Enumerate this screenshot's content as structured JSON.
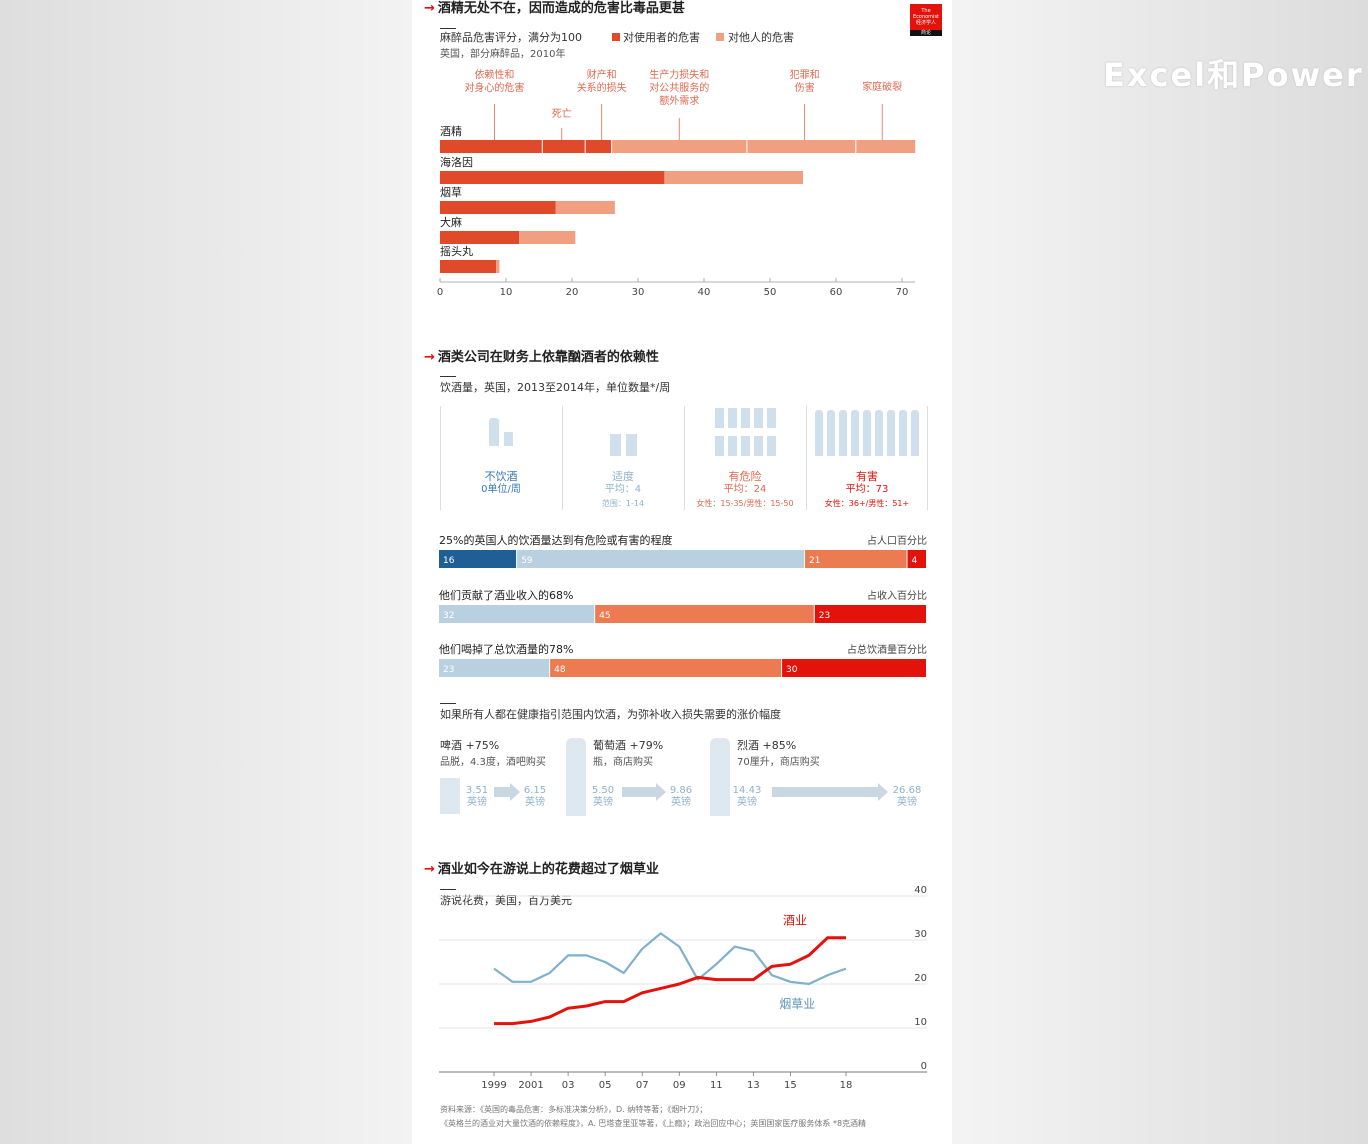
{
  "watermark": "Excel和Power",
  "logo": {
    "line1": "The",
    "line2": "Economist",
    "line3": "经济学人",
    "line4": "商论"
  },
  "section1": {
    "title": "酒精无处不在，因而造成的危害比毒品更甚",
    "subtitle": "麻醉品危害评分，满分为100",
    "legend_user": "对使用者的危害",
    "legend_others": "对他人的危害",
    "note": "英国，部分麻醉品，2010年",
    "annotations": {
      "dependence": "依赖性和\n对身心的危害",
      "death": "死亡",
      "property": "财产和\n关系的损失",
      "productivity": "生产力损失和\n对公共服务的\n额外需求",
      "crime": "犯罪和\n伤害",
      "family": "家庭破裂"
    }
  },
  "section2": {
    "title": "酒类公司在财务上依靠酗酒者的依赖性",
    "subtitle": "饮酒量，英国，2013至2014年，单位数量*/周",
    "groups": [
      {
        "name": "不饮酒",
        "sub1": "0单位/周",
        "sub2": ""
      },
      {
        "name": "适度",
        "sub1": "平均：4",
        "sub2": "范围：1-14"
      },
      {
        "name": "有危险",
        "sub1": "平均：24",
        "sub2": "女性：15-35/男性：15-50"
      },
      {
        "name": "有害",
        "sub1": "平均：73",
        "sub2": "女性：36+/男性：51+"
      }
    ],
    "bars": [
      {
        "label": "25%的英国人的饮酒量达到有危险或有害的程度",
        "unit": "占人口百分比"
      },
      {
        "label": "他们贡献了酒业收入的68%",
        "unit": "占收入百分比"
      },
      {
        "label": "他们喝掉了总饮酒量的78%",
        "unit": "占总饮酒量百分比"
      }
    ],
    "price": {
      "title": "如果所有人都在健康指引范围内饮酒，为弥补收入损失需要的涨价幅度",
      "items": [
        {
          "name": "啤酒 +75%",
          "desc": "品脱，4.3度，酒吧购买",
          "from": "3.51",
          "to": "6.15",
          "unit": "英镑"
        },
        {
          "name": "葡萄酒 +79%",
          "desc": "瓶，商店购买",
          "from": "5.50",
          "to": "9.86",
          "unit": "英镑"
        },
        {
          "name": "烈酒 +85%",
          "desc": "70厘升，商店购买",
          "from": "14.43",
          "to": "26.68",
          "unit": "英镑"
        }
      ]
    }
  },
  "section3": {
    "title": "酒业如今在游说上的花费超过了烟草业",
    "subtitle": "游说花费，美国，百万美元",
    "label_alcohol": "酒业",
    "label_tobacco": "烟草业"
  },
  "source": {
    "line1": "资料来源：《英国的毒品危害：多标准决策分析》，D. 纳特等著；《烟叶刀》；",
    "line2": "《英格兰的酒业对大量饮酒的依赖程度》，A. 巴塔查里亚等著，《上瘾》；政治回应中心；英国国家医疗服务体系   *8克酒精"
  },
  "chart_data": [
    {
      "type": "bar",
      "title": "酒精无处不在，因而造成的危害比毒品更甚",
      "subtitle": "麻醉品危害评分，满分为100",
      "orientation": "horizontal",
      "stacked": true,
      "categories": [
        "酒精",
        "海洛因",
        "烟草",
        "大麻",
        "摇头丸"
      ],
      "series": [
        {
          "name": "对使用者的危害",
          "values": [
            26,
            34,
            17.5,
            12,
            8.5
          ],
          "color": "#e04a2b"
        },
        {
          "name": "对他人的危害",
          "values": [
            46,
            21,
            9,
            8.5,
            0.5
          ],
          "color": "#f0a080"
        }
      ],
      "alcohol_breakdown": {
        "dependence": 15.5,
        "death": 6.5,
        "property": 4,
        "productivity": 20.5,
        "crime": 16.5,
        "family": 9
      },
      "xlim": [
        0,
        72
      ],
      "xticks": [
        0,
        10,
        20,
        30,
        40,
        50,
        60,
        70
      ]
    },
    {
      "type": "bar",
      "orientation": "horizontal",
      "stacked": true,
      "categories": [
        "不饮酒",
        "适度",
        "有危险",
        "有害"
      ],
      "colors": [
        "#1f5f95",
        "#b9d0e0",
        "#ed7b52",
        "#e3120b"
      ],
      "series": [
        {
          "name": "25%的英国人的饮酒量达到有危险或有害的程度",
          "values": [
            16,
            59,
            21,
            4
          ]
        },
        {
          "name": "他们贡献了酒业收入的68%",
          "values": [
            0,
            32,
            45,
            23
          ]
        },
        {
          "name": "他们喝掉了总饮酒量的78%",
          "values": [
            0,
            23,
            48,
            30
          ]
        }
      ],
      "unit": "%"
    },
    {
      "type": "line",
      "title": "酒业如今在游说上的花费超过了烟草业",
      "subtitle": "游说花费，美国，百万美元",
      "x": [
        1999,
        2000,
        2001,
        2002,
        2003,
        2004,
        2005,
        2006,
        2007,
        2008,
        2009,
        2010,
        2011,
        2012,
        2013,
        2014,
        2015,
        2016,
        2017,
        2018
      ],
      "xticks": [
        "1999",
        "2001",
        "03",
        "05",
        "07",
        "09",
        "11",
        "13",
        "15",
        "18"
      ],
      "tick_years": [
        1999,
        2001,
        2003,
        2005,
        2007,
        2009,
        2011,
        2013,
        2015,
        2018
      ],
      "series": [
        {
          "name": "酒业",
          "color": "#e3120b",
          "values": [
            11,
            11,
            11.5,
            12.5,
            14.5,
            15,
            16,
            16,
            18,
            19,
            20,
            21.5,
            21,
            21,
            21,
            24,
            24.5,
            26.5,
            30.5,
            30.5
          ]
        },
        {
          "name": "烟草业",
          "color": "#7fb0cc",
          "values": [
            23.5,
            20.5,
            20.5,
            22.5,
            26.5,
            26.5,
            25,
            22.5,
            28,
            31.5,
            28.5,
            21,
            24.5,
            28.5,
            27.5,
            22,
            20.5,
            20,
            22,
            23.5
          ]
        }
      ],
      "ylim": [
        0,
        40
      ],
      "yticks": [
        0,
        10,
        20,
        30,
        40
      ],
      "grid": true
    }
  ]
}
